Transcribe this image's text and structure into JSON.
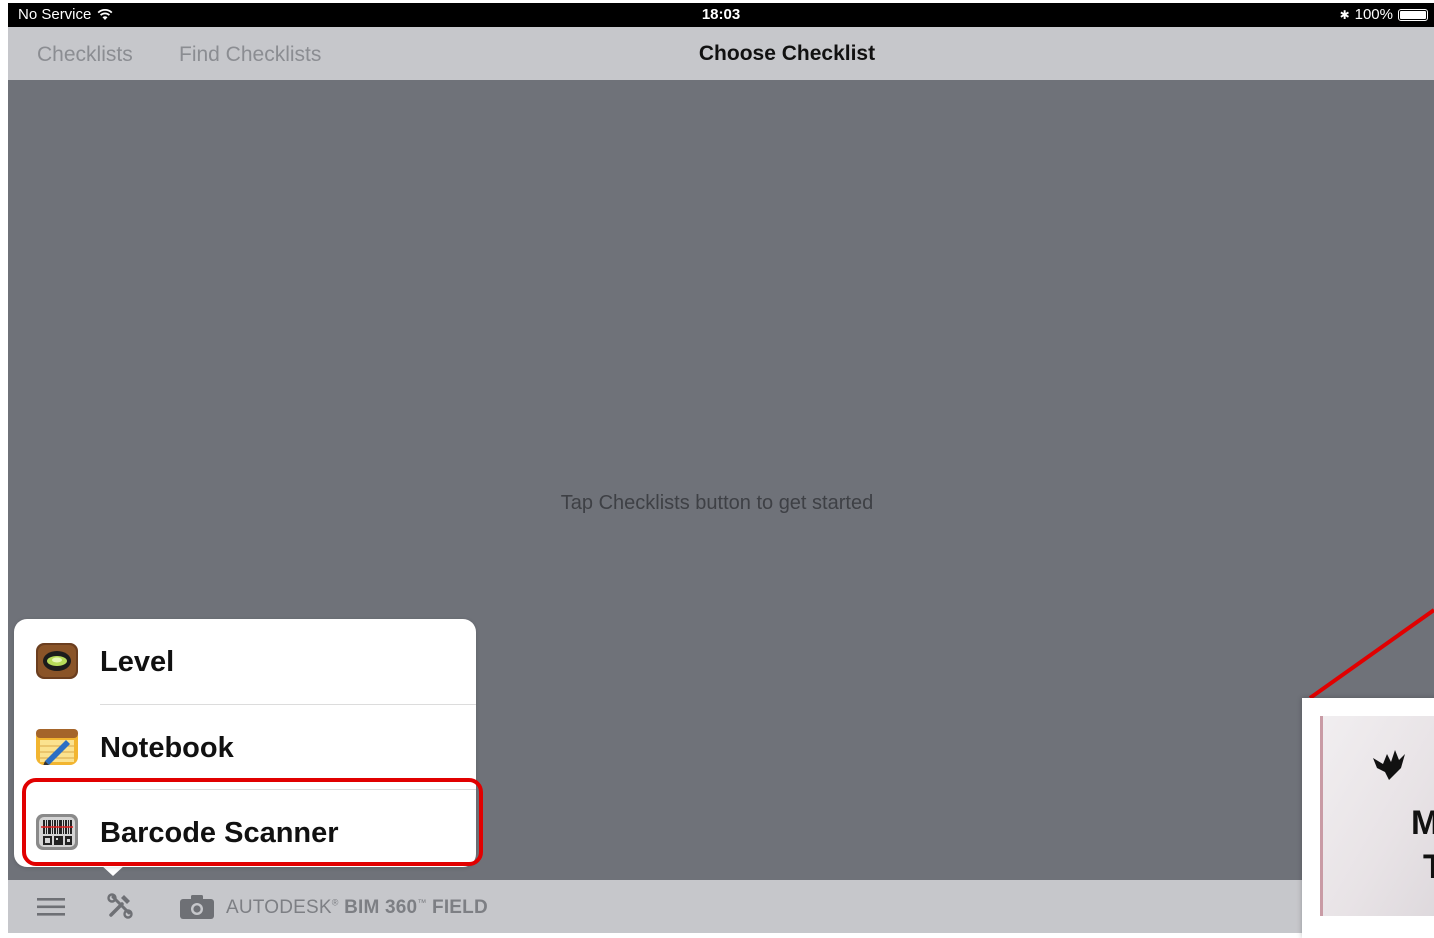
{
  "status_bar": {
    "carrier": "No Service",
    "time": "18:03",
    "bluetooth": "✱",
    "battery": "100%"
  },
  "nav": {
    "back_label": "Checklists",
    "find_label": "Find Checklists",
    "title": "Choose Checklist"
  },
  "main": {
    "empty_message": "Tap Checklists button to get started"
  },
  "popover": {
    "items": [
      {
        "label": "Level",
        "icon": "level-app-icon"
      },
      {
        "label": "Notebook",
        "icon": "notebook-app-icon"
      },
      {
        "label": "Barcode Scanner",
        "icon": "barcode-scanner-app-icon"
      }
    ]
  },
  "toolbar": {
    "brand_autodesk": "AUTODESK",
    "brand_reg": "®",
    "brand_product": "BIM 360",
    "brand_tm": "™",
    "brand_field": "FIELD"
  },
  "inset": {
    "letter_1": "M",
    "letter_2": "T"
  },
  "colors": {
    "highlight": "#e10000",
    "screen_bg": "#6f7279",
    "bar_bg": "#c6c7cb"
  }
}
